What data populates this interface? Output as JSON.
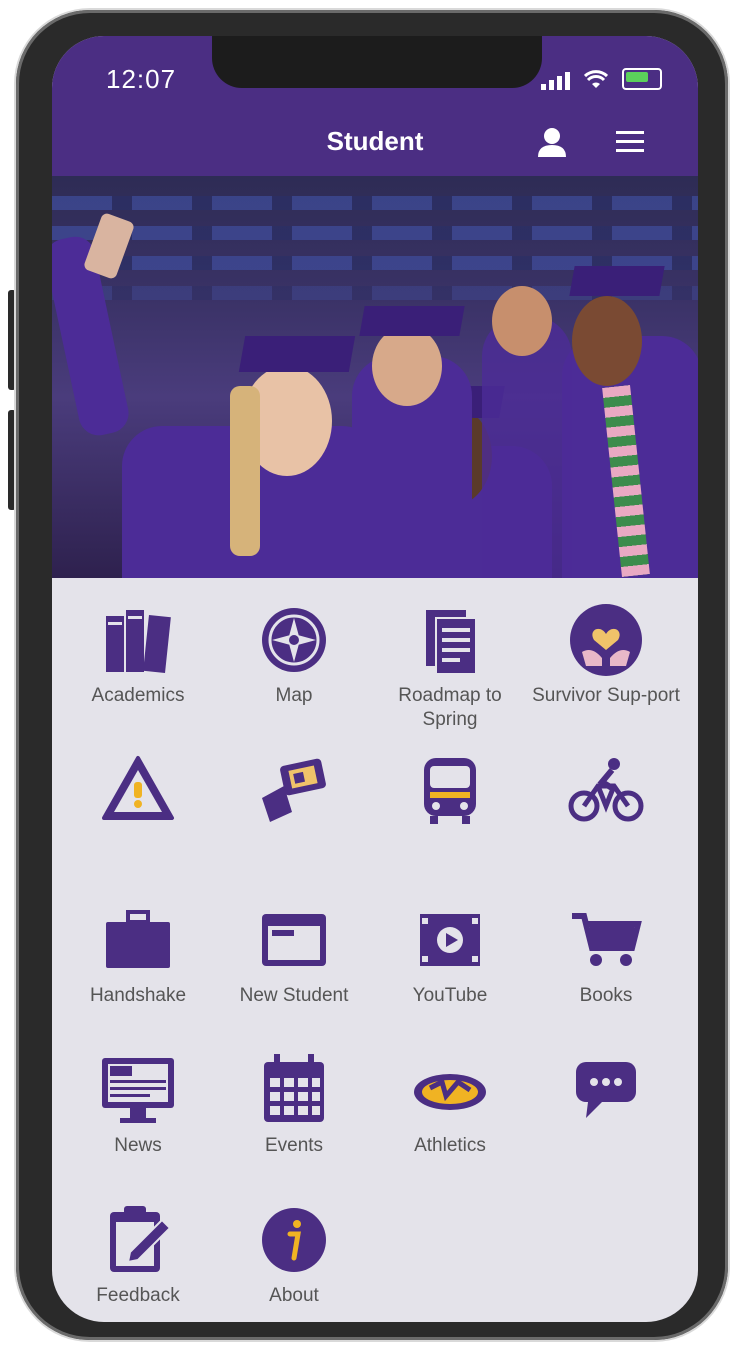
{
  "status_bar": {
    "time": "12:07"
  },
  "header": {
    "title": "Student"
  },
  "colors": {
    "brand": "#4b2e83",
    "gold": "#c8a84b",
    "tile_bg": "#e4e3ea",
    "label": "#555555"
  },
  "tiles": [
    {
      "label": "Academics",
      "icon": "books-icon"
    },
    {
      "label": "Map",
      "icon": "compass-icon"
    },
    {
      "label": "Roadmap to Spring",
      "icon": "document-icon"
    },
    {
      "label": "Survivor Sup-port",
      "icon": "hands-heart-icon"
    },
    {
      "label": "",
      "icon": "warning-icon"
    },
    {
      "label": "",
      "icon": "card-icon"
    },
    {
      "label": "",
      "icon": "bus-icon"
    },
    {
      "label": "",
      "icon": "bicycle-icon"
    },
    {
      "label": "Handshake",
      "icon": "briefcase-icon"
    },
    {
      "label": "New Student",
      "icon": "laptop-icon"
    },
    {
      "label": "YouTube",
      "icon": "video-icon"
    },
    {
      "label": "Books",
      "icon": "cart-icon"
    },
    {
      "label": "News",
      "icon": "news-monitor-icon"
    },
    {
      "label": "Events",
      "icon": "calendar-icon"
    },
    {
      "label": "Athletics",
      "icon": "athletics-logo-icon"
    },
    {
      "label": "",
      "icon": "chat-icon"
    },
    {
      "label": "Feedback",
      "icon": "clipboard-icon"
    },
    {
      "label": "About",
      "icon": "info-icon"
    }
  ]
}
